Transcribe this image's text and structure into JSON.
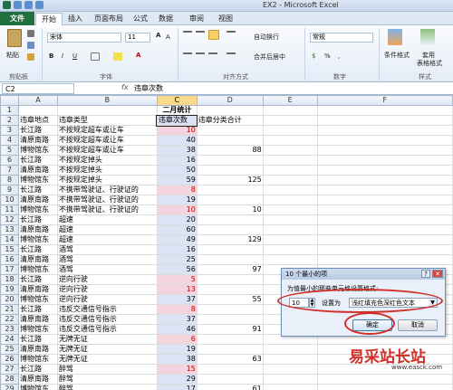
{
  "window": {
    "title": "EX2 - Microsoft Excel"
  },
  "tabs": [
    {
      "label": "文件"
    },
    {
      "label": "开始"
    },
    {
      "label": "插入"
    },
    {
      "label": "页面布局"
    },
    {
      "label": "公式"
    },
    {
      "label": "数据"
    },
    {
      "label": "审阅"
    },
    {
      "label": "视图"
    }
  ],
  "ribbon": {
    "paste_label": "粘贴",
    "clipboard_group": "剪贴板",
    "font_name": "宋体",
    "font_size": "11",
    "font_group": "字体",
    "wrap_text": "自动换行",
    "merge_center": "合并后居中",
    "alignment_group": "对齐方式",
    "number_format": "常规",
    "number_group": "数字",
    "cond_format": "条件格式",
    "table_format_1": "套用",
    "table_format_2": "表格格式",
    "styles_group": "样式",
    "cell_styles": "单元格样式"
  },
  "formula_bar": {
    "name_box": "C2",
    "fx": "fx",
    "content": "违章次数"
  },
  "columns": [
    "A",
    "B",
    "C",
    "D",
    "E",
    "F"
  ],
  "rows": [
    {
      "n": "1",
      "a": "",
      "b": "",
      "c": "二月统计",
      "d": "",
      "hl": false
    },
    {
      "n": "2",
      "a": "违章地点",
      "b": "违章类型",
      "c": "违章次数",
      "d": "违章分类合计",
      "hl": false
    },
    {
      "n": "3",
      "a": "长江路",
      "b": "不按规定超车或让车",
      "c": "10",
      "d": "",
      "hl": true
    },
    {
      "n": "4",
      "a": "清原南路",
      "b": "不按规定超车或让车",
      "c": "40",
      "d": "",
      "hl": false
    },
    {
      "n": "5",
      "a": "博物馆东",
      "b": "不按规定超车或让车",
      "c": "38",
      "d": "88",
      "hl": false
    },
    {
      "n": "6",
      "a": "长江路",
      "b": "不按规定掉头",
      "c": "16",
      "d": "",
      "hl": false
    },
    {
      "n": "7",
      "a": "清原南路",
      "b": "不按规定掉头",
      "c": "50",
      "d": "",
      "hl": false
    },
    {
      "n": "8",
      "a": "博物馆东",
      "b": "不按规定掉头",
      "c": "59",
      "d": "125",
      "hl": false
    },
    {
      "n": "9",
      "a": "长江路",
      "b": "不携带驾驶证、行驶证的",
      "c": "8",
      "d": "",
      "hl": true
    },
    {
      "n": "10",
      "a": "清原南路",
      "b": "不携带驾驶证、行驶证的",
      "c": "19",
      "d": "",
      "hl": false
    },
    {
      "n": "11",
      "a": "博物馆东",
      "b": "不携带驾驶证、行驶证的",
      "c": "10",
      "d": "10",
      "hl": true
    },
    {
      "n": "12",
      "a": "长江路",
      "b": "超速",
      "c": "20",
      "d": "",
      "hl": false
    },
    {
      "n": "13",
      "a": "清原南路",
      "b": "超速",
      "c": "60",
      "d": "",
      "hl": false
    },
    {
      "n": "14",
      "a": "博物馆东",
      "b": "超速",
      "c": "49",
      "d": "129",
      "hl": false
    },
    {
      "n": "15",
      "a": "长江路",
      "b": "酒驾",
      "c": "16",
      "d": "",
      "hl": false
    },
    {
      "n": "16",
      "a": "清原南路",
      "b": "酒驾",
      "c": "25",
      "d": "",
      "hl": false
    },
    {
      "n": "17",
      "a": "博物馆东",
      "b": "酒驾",
      "c": "56",
      "d": "97",
      "hl": false
    },
    {
      "n": "18",
      "a": "长江路",
      "b": "逆向行驶",
      "c": "5",
      "d": "",
      "hl": true
    },
    {
      "n": "19",
      "a": "清原南路",
      "b": "逆向行驶",
      "c": "13",
      "d": "",
      "hl": true
    },
    {
      "n": "20",
      "a": "博物馆东",
      "b": "逆向行驶",
      "c": "37",
      "d": "55",
      "hl": false
    },
    {
      "n": "21",
      "a": "长江路",
      "b": "违反交通信号指示",
      "c": "8",
      "d": "",
      "hl": true
    },
    {
      "n": "22",
      "a": "清原南路",
      "b": "违反交通信号指示",
      "c": "37",
      "d": "",
      "hl": false
    },
    {
      "n": "23",
      "a": "博物馆东",
      "b": "违反交通信号指示",
      "c": "46",
      "d": "91",
      "hl": false
    },
    {
      "n": "24",
      "a": "长江路",
      "b": "无牌无证",
      "c": "6",
      "d": "",
      "hl": true
    },
    {
      "n": "25",
      "a": "清原南路",
      "b": "无牌无证",
      "c": "19",
      "d": "",
      "hl": false
    },
    {
      "n": "26",
      "a": "博物馆东",
      "b": "无牌无证",
      "c": "38",
      "d": "63",
      "hl": false
    },
    {
      "n": "27",
      "a": "长江路",
      "b": "醉驾",
      "c": "15",
      "d": "",
      "hl": true
    },
    {
      "n": "28",
      "a": "清原南路",
      "b": "醉驾",
      "c": "29",
      "d": "",
      "hl": false
    },
    {
      "n": "29",
      "a": "博物馆东",
      "b": "醉驾",
      "c": "17",
      "d": "61",
      "hl": false
    }
  ],
  "dialog": {
    "title": "10 个最小的项",
    "prompt": "为值最小的那些单元格设置格式:",
    "count": "10",
    "set_as": "设置为",
    "format": "浅红填充色深红色文本",
    "ok": "确定",
    "cancel": "取消"
  },
  "watermark": {
    "brand": "易采站长站",
    "url": "www.easck.com"
  },
  "colors": {
    "file_tab": "#1f6f3f",
    "highlight_fill": "#f6d4dd",
    "highlight_text": "#c00000",
    "range_fill": "#dce3f5",
    "annotation_red": "#d0302a"
  }
}
